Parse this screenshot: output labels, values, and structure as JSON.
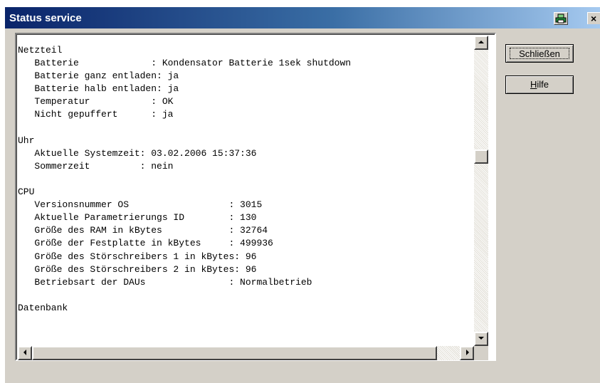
{
  "window": {
    "title": "Status service",
    "close_glyph": "×"
  },
  "buttons": {
    "close_label": "Schließen",
    "help_label_prefix": "",
    "help_label_accel": "H",
    "help_label_rest": "ilfe"
  },
  "sections": [
    {
      "header": "Netzteil",
      "lines": [
        "   Batterie             : Kondensator Batterie 1sek shutdown",
        "   Batterie ganz entladen: ja",
        "   Batterie halb entladen: ja",
        "   Temperatur           : OK",
        "   Nicht gepuffert      : ja"
      ]
    },
    {
      "header": "Uhr",
      "lines": [
        "   Aktuelle Systemzeit: 03.02.2006 15:37:36",
        "   Sommerzeit         : nein"
      ]
    },
    {
      "header": "CPU",
      "lines": [
        "   Versionsnummer OS                  : 3015",
        "   Aktuelle Parametrierungs ID        : 130",
        "   Größe des RAM in kBytes            : 32764",
        "   Größe der Festplatte in kBytes     : 499936",
        "   Größe des Störschreibers 1 in kBytes: 96",
        "   Größe des Störschreibers 2 in kBytes: 96",
        "   Betriebsart der DAUs               : Normalbetrieb"
      ]
    },
    {
      "header": "Datenbank",
      "lines": []
    }
  ],
  "icons": {
    "print": "printer-icon",
    "up": "arrow-up-icon",
    "down": "arrow-down-icon",
    "left": "arrow-left-icon",
    "right": "arrow-right-icon"
  },
  "colors": {
    "title_start": "#0a246a",
    "title_end": "#a6caf0",
    "face": "#d4d0c8"
  }
}
